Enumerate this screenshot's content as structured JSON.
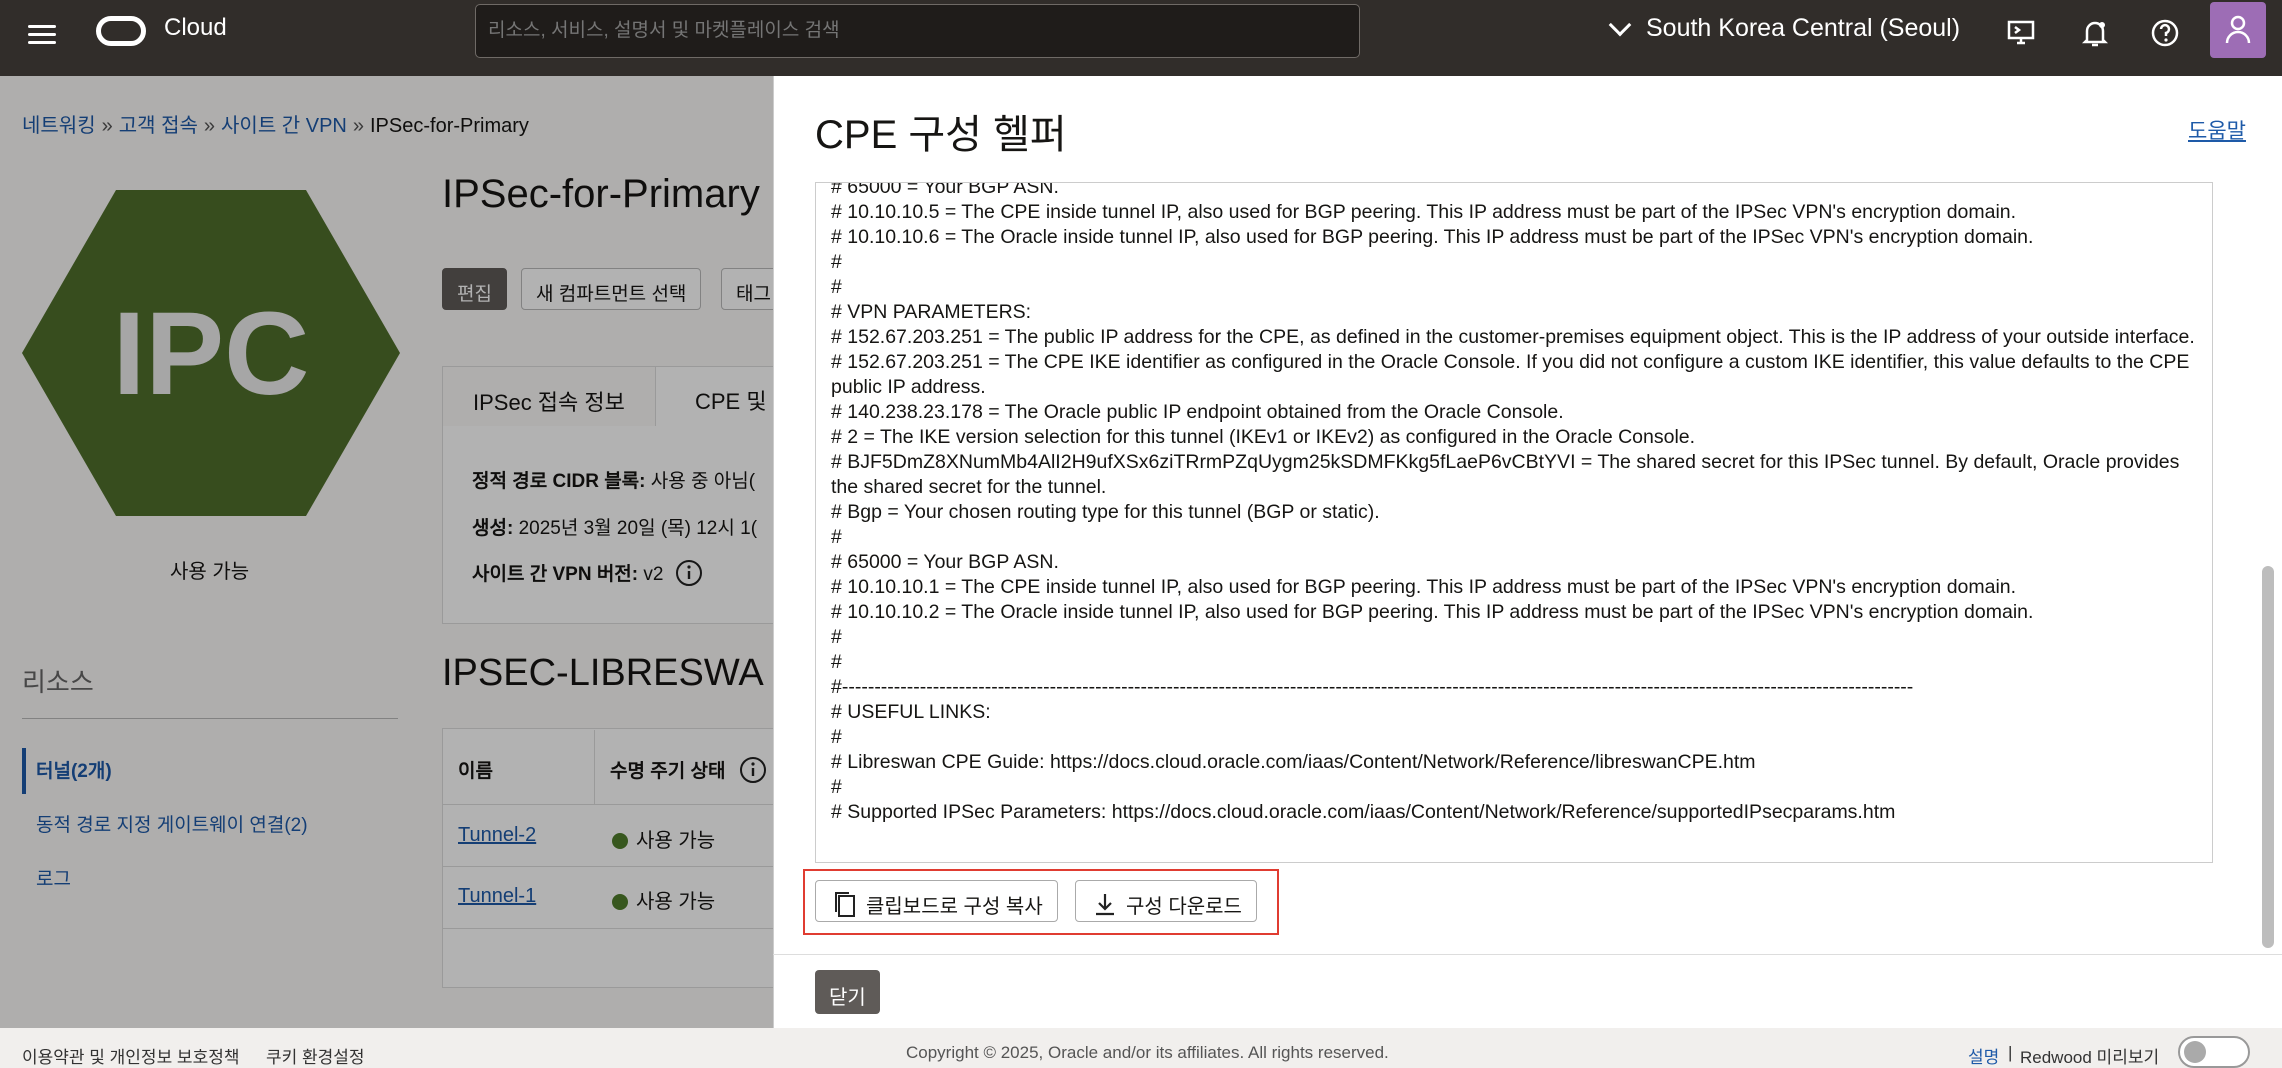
{
  "header": {
    "app_name": "Cloud",
    "search_placeholder": "리소스, 서비스, 설명서 및 마켓플레이스 검색",
    "region": "South Korea Central (Seoul)"
  },
  "breadcrumb": [
    "네트워킹",
    "고객 접속",
    "사이트 간 VPN",
    "IPSec-for-Primary"
  ],
  "resource": {
    "icon_text": "IPC",
    "icon_color": "#4f6f2c",
    "status": "사용 가능",
    "title": "IPSec-for-Primary",
    "buttons": [
      "편집",
      "새 컴파트먼트 선택",
      "태그"
    ],
    "tabs": [
      "IPSec 접속 정보",
      "CPE 및"
    ],
    "info": [
      {
        "label": "정적 경로 CIDR 블록:",
        "value": "사용 중 아님("
      },
      {
        "label": "생성:",
        "value": "2025년 3월 20일 (목) 12시 1("
      },
      {
        "label": "사이트 간 VPN 버전:",
        "value": "v2"
      }
    ],
    "section_title": "IPSEC-LIBRESWA"
  },
  "resources_nav": {
    "title": "리소스",
    "items": [
      "터널(2개)",
      "동적 경로 지정 게이트웨이 연결(2)",
      "로그"
    ]
  },
  "tunnels_table": {
    "headers": [
      "이름",
      "수명 주기 상태"
    ],
    "rows": [
      {
        "name": "Tunnel-2",
        "state": "사용 가능"
      },
      {
        "name": "Tunnel-1",
        "state": "사용 가능"
      }
    ]
  },
  "drawer": {
    "title": "CPE 구성 헬퍼",
    "help": "도움말",
    "config_text": "# 65000 = Your BGP ASN.\n# 10.10.10.5 = The CPE inside tunnel IP, also used for BGP peering. This IP address must be part of the IPSec VPN's encryption domain.\n# 10.10.10.6 = The Oracle inside tunnel IP, also used for BGP peering. This IP address must be part of the IPSec VPN's encryption domain.\n#\n#\n# VPN PARAMETERS:\n# 152.67.203.251 = The public IP address for the CPE, as defined in the customer-premises equipment object. This is the IP address of your outside interface.\n# 152.67.203.251 = The CPE IKE identifier as configured in the Oracle Console. If you did not configure a custom IKE identifier, this value defaults to the CPE public IP address.\n# 140.238.23.178 = The Oracle public IP endpoint obtained from the Oracle Console.\n# 2 = The IKE version selection for this tunnel (IKEv1 or IKEv2) as configured in the Oracle Console.\n# BJF5DmZ8XNumMb4AlI2H9ufXSx6ziTRrmPZqUygm25kSDMFKkg5fLaeP6vCBtYVI = The shared secret for this IPSec tunnel. By default, Oracle provides the shared secret for the tunnel.\n# Bgp = Your chosen routing type for this tunnel (BGP or static).\n#\n# 65000 = Your BGP ASN.\n# 10.10.10.1 = The CPE inside tunnel IP, also used for BGP peering. This IP address must be part of the IPSec VPN's encryption domain.\n# 10.10.10.2 = The Oracle inside tunnel IP, also used for BGP peering. This IP address must be part of the IPSec VPN's encryption domain.\n#\n#\n#---------------------------------------------------------------------------------------------------------------------------------------------------------------------\n# USEFUL LINKS:\n#\n# Libreswan CPE Guide: https://docs.cloud.oracle.com/iaas/Content/Network/Reference/libreswanCPE.htm\n#\n# Supported IPSec Parameters: https://docs.cloud.oracle.com/iaas/Content/Network/Reference/supportedIPsecparams.htm",
    "copy_button": "클립보드로 구성 복사",
    "download_button": "구성 다운로드",
    "close_button": "닫기"
  },
  "footer": {
    "terms": "이용약관 및 개인정보 보호정책",
    "cookies": "쿠키 환경설정",
    "copyright": "Copyright © 2025, Oracle and/or its affiliates. All rights reserved.",
    "docs": "설명",
    "divider": "|",
    "redwood": "Redwood 미리보기"
  }
}
